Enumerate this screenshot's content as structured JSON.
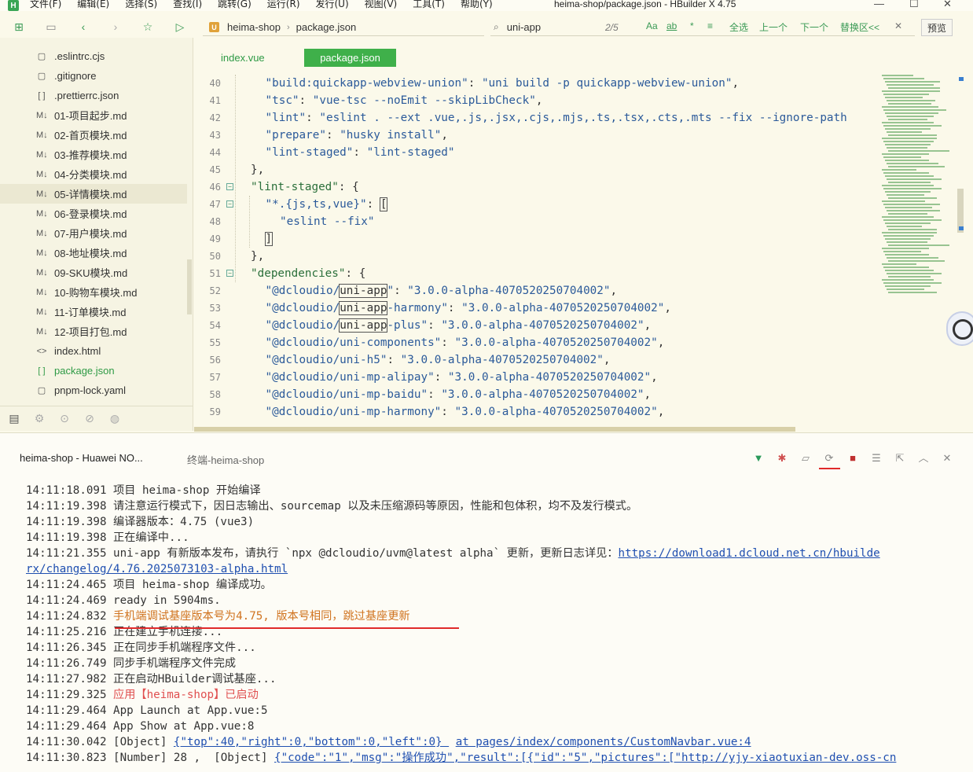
{
  "menu": {
    "items": [
      "文件(F)",
      "编辑(E)",
      "选择(S)",
      "查找(I)",
      "跳转(G)",
      "运行(R)",
      "发行(U)",
      "视图(V)",
      "工具(T)",
      "帮助(Y)"
    ],
    "window_title": "heima-shop/package.json - HBuilder X 4.75",
    "logo": "H"
  },
  "toolbar": {
    "address": {
      "project": "heima-shop",
      "file": "package.json",
      "icon": "U"
    },
    "search": {
      "value": "uni-app",
      "count": "2/5"
    },
    "search_options": [
      "Aa",
      "ab",
      "*",
      "≡",
      "全选",
      "上一个",
      "下一个",
      "替换区<<",
      "✕"
    ],
    "preview_label": "预览"
  },
  "sidebar": {
    "files": [
      {
        "name": ".eslintrc.cjs",
        "icon": "▢"
      },
      {
        "name": ".gitignore",
        "icon": "▢"
      },
      {
        "name": ".prettierrc.json",
        "icon": "[ ]"
      },
      {
        "name": "01-项目起步.md",
        "icon": "M↓"
      },
      {
        "name": "02-首页模块.md",
        "icon": "M↓"
      },
      {
        "name": "03-推荐模块.md",
        "icon": "M↓"
      },
      {
        "name": "04-分类模块.md",
        "icon": "M↓"
      },
      {
        "name": "05-详情模块.md",
        "icon": "M↓"
      },
      {
        "name": "06-登录模块.md",
        "icon": "M↓"
      },
      {
        "name": "07-用户模块.md",
        "icon": "M↓"
      },
      {
        "name": "08-地址模块.md",
        "icon": "M↓"
      },
      {
        "name": "09-SKU模块.md",
        "icon": "M↓"
      },
      {
        "name": "10-购物车模块.md",
        "icon": "M↓"
      },
      {
        "name": "11-订单模块.md",
        "icon": "M↓"
      },
      {
        "name": "12-项目打包.md",
        "icon": "M↓"
      },
      {
        "name": "index.html",
        "icon": "<>"
      },
      {
        "name": "package.json",
        "icon": "[ ]"
      },
      {
        "name": "pnpm-lock.yaml",
        "icon": "▢"
      }
    ],
    "selected_index": 7,
    "active_index": 16
  },
  "editor": {
    "tabs": [
      {
        "label": "index.vue"
      },
      {
        "label": "package.json"
      }
    ],
    "lines": [
      {
        "n": "40",
        "fold": false,
        "indent": 2,
        "parts": [
          [
            "s",
            "\"build:quickapp-webview-union\""
          ],
          [
            "p",
            ": "
          ],
          [
            "s",
            "\"uni build -p quickapp-webview-union\""
          ],
          [
            "p",
            ","
          ]
        ]
      },
      {
        "n": "41",
        "fold": false,
        "indent": 2,
        "parts": [
          [
            "s",
            "\"tsc\""
          ],
          [
            "p",
            ": "
          ],
          [
            "s",
            "\"vue-tsc --noEmit --skipLibCheck\""
          ],
          [
            "p",
            ","
          ]
        ]
      },
      {
        "n": "42",
        "fold": false,
        "indent": 2,
        "parts": [
          [
            "s",
            "\"lint\""
          ],
          [
            "p",
            ": "
          ],
          [
            "s",
            "\"eslint . --ext .vue,.js,.jsx,.cjs,.mjs,.ts,.tsx,.cts,.mts --fix --ignore-path"
          ]
        ]
      },
      {
        "n": "43",
        "fold": false,
        "indent": 2,
        "parts": [
          [
            "s",
            "\"prepare\""
          ],
          [
            "p",
            ": "
          ],
          [
            "s",
            "\"husky install\""
          ],
          [
            "p",
            ","
          ]
        ]
      },
      {
        "n": "44",
        "fold": false,
        "indent": 2,
        "parts": [
          [
            "s",
            "\"lint-staged\""
          ],
          [
            "p",
            ": "
          ],
          [
            "s",
            "\"lint-staged\""
          ]
        ]
      },
      {
        "n": "45",
        "fold": false,
        "indent": 1,
        "parts": [
          [
            "p",
            "},"
          ]
        ]
      },
      {
        "n": "46",
        "fold": true,
        "indent": 1,
        "parts": [
          [
            "k",
            "\"lint-staged\""
          ],
          [
            "p",
            ": {"
          ]
        ]
      },
      {
        "n": "47",
        "fold": true,
        "indent": 2,
        "parts": [
          [
            "s",
            "\"*.{js,ts,vue}\""
          ],
          [
            "p",
            ": "
          ],
          [
            "box",
            "["
          ]
        ]
      },
      {
        "n": "48",
        "fold": false,
        "indent": 3,
        "parts": [
          [
            "s",
            "\"eslint --fix\""
          ]
        ]
      },
      {
        "n": "49",
        "fold": false,
        "indent": 2,
        "parts": [
          [
            "box",
            "]"
          ]
        ]
      },
      {
        "n": "50",
        "fold": false,
        "indent": 1,
        "parts": [
          [
            "p",
            "},"
          ]
        ]
      },
      {
        "n": "51",
        "fold": true,
        "indent": 1,
        "parts": [
          [
            "k",
            "\"dependencies\""
          ],
          [
            "p",
            ": {"
          ]
        ]
      },
      {
        "n": "52",
        "fold": false,
        "indent": 2,
        "parts": [
          [
            "s",
            "\"@dcloudio/"
          ],
          [
            "box",
            "uni-app"
          ],
          [
            "s",
            "\""
          ],
          [
            "p",
            ": "
          ],
          [
            "s",
            "\"3.0.0-alpha-4070520250704002\""
          ],
          [
            "p",
            ","
          ]
        ]
      },
      {
        "n": "53",
        "fold": false,
        "indent": 2,
        "parts": [
          [
            "s",
            "\"@dcloudio/"
          ],
          [
            "box",
            "uni-app"
          ],
          [
            "s",
            "-harmony\""
          ],
          [
            "p",
            ": "
          ],
          [
            "s",
            "\"3.0.0-alpha-4070520250704002\""
          ],
          [
            "p",
            ","
          ]
        ]
      },
      {
        "n": "54",
        "fold": false,
        "indent": 2,
        "parts": [
          [
            "s",
            "\"@dcloudio/"
          ],
          [
            "box",
            "uni-app"
          ],
          [
            "s",
            "-plus\""
          ],
          [
            "p",
            ": "
          ],
          [
            "s",
            "\"3.0.0-alpha-4070520250704002\""
          ],
          [
            "p",
            ","
          ]
        ]
      },
      {
        "n": "55",
        "fold": false,
        "indent": 2,
        "parts": [
          [
            "s",
            "\"@dcloudio/uni-components\""
          ],
          [
            "p",
            ": "
          ],
          [
            "s",
            "\"3.0.0-alpha-4070520250704002\""
          ],
          [
            "p",
            ","
          ]
        ]
      },
      {
        "n": "56",
        "fold": false,
        "indent": 2,
        "parts": [
          [
            "s",
            "\"@dcloudio/uni-h5\""
          ],
          [
            "p",
            ": "
          ],
          [
            "s",
            "\"3.0.0-alpha-4070520250704002\""
          ],
          [
            "p",
            ","
          ]
        ]
      },
      {
        "n": "57",
        "fold": false,
        "indent": 2,
        "parts": [
          [
            "s",
            "\"@dcloudio/uni-mp-alipay\""
          ],
          [
            "p",
            ": "
          ],
          [
            "s",
            "\"3.0.0-alpha-4070520250704002\""
          ],
          [
            "p",
            ","
          ]
        ]
      },
      {
        "n": "58",
        "fold": false,
        "indent": 2,
        "parts": [
          [
            "s",
            "\"@dcloudio/uni-mp-baidu\""
          ],
          [
            "p",
            ": "
          ],
          [
            "s",
            "\"3.0.0-alpha-4070520250704002\""
          ],
          [
            "p",
            ","
          ]
        ]
      },
      {
        "n": "59",
        "fold": false,
        "indent": 2,
        "parts": [
          [
            "s",
            "\"@dcloudio/uni-mp-harmony\""
          ],
          [
            "p",
            ": "
          ],
          [
            "s",
            "\"3.0.0-alpha-4070520250704002\""
          ],
          [
            "p",
            ","
          ]
        ]
      }
    ]
  },
  "console": {
    "tabs": [
      {
        "label": "heima-shop - Huawei NO..."
      },
      {
        "label": "终端-heima-shop"
      }
    ],
    "lines": [
      {
        "time": "14:11:18.091",
        "parts": [
          [
            "t",
            "项目 heima-shop 开始编译"
          ]
        ]
      },
      {
        "time": "14:11:19.398",
        "parts": [
          [
            "t",
            "请注意运行模式下，因日志输出、sourcemap 以及未压缩源码等原因，性能和包体积，均不及发行模式。"
          ]
        ]
      },
      {
        "time": "14:11:19.398",
        "parts": [
          [
            "t",
            "编译器版本：4.75 (vue3)"
          ]
        ]
      },
      {
        "time": "14:11:19.398",
        "parts": [
          [
            "t",
            "正在编译中..."
          ]
        ]
      },
      {
        "time": "14:11:21.355",
        "parts": [
          [
            "t",
            "uni-app 有新版本发布，请执行 `npx @dcloudio/uvm@latest alpha` 更新，更新日志详见："
          ],
          [
            "link",
            "https://download1.dcloud.net.cn/hbuilde"
          ]
        ]
      },
      {
        "time": "",
        "parts": [
          [
            "link",
            "rx/changelog/4.76.2025073103-alpha.html"
          ]
        ]
      },
      {
        "time": "14:11:24.465",
        "parts": [
          [
            "t",
            "项目 heima-shop 编译成功。"
          ]
        ]
      },
      {
        "time": "14:11:24.469",
        "parts": [
          [
            "t",
            "ready in 5904ms."
          ]
        ]
      },
      {
        "time": "14:11:24.832",
        "parts": [
          [
            "orange",
            "手机端调试基座版本号为4.75, 版本号相同，跳过基座更新"
          ]
        ]
      },
      {
        "time": "14:11:25.216",
        "parts": [
          [
            "t",
            "正在建立手机连接..."
          ]
        ]
      },
      {
        "time": "14:11:26.345",
        "parts": [
          [
            "t",
            "正在同步手机端程序文件..."
          ]
        ]
      },
      {
        "time": "14:11:26.749",
        "parts": [
          [
            "t",
            "同步手机端程序文件完成"
          ]
        ]
      },
      {
        "time": "14:11:27.982",
        "parts": [
          [
            "t",
            "正在启动HBuilder调试基座..."
          ]
        ]
      },
      {
        "time": "14:11:29.325",
        "parts": [
          [
            "red",
            "应用【heima-shop】已启动"
          ]
        ]
      },
      {
        "time": "14:11:29.464",
        "parts": [
          [
            "t",
            "App Launch at App.vue:5"
          ]
        ]
      },
      {
        "time": "14:11:29.464",
        "parts": [
          [
            "t",
            "App Show at App.vue:8"
          ]
        ]
      },
      {
        "time": "14:11:30.042",
        "parts": [
          [
            "t",
            "[Object] "
          ],
          [
            "link",
            "{\"top\":40,\"right\":0,\"bottom\":0,\"left\":0} "
          ],
          [
            "t",
            " "
          ],
          [
            "link",
            "at pages/index/components/CustomNavbar.vue:4"
          ]
        ]
      },
      {
        "time": "14:11:30.823",
        "parts": [
          [
            "t",
            "[Number] 28 ,  [Object] "
          ],
          [
            "link",
            "{\"code\":\"1\",\"msg\":\"操作成功\",\"result\":[{\"id\":\"5\",\"pictures\":[\"http://yjy-xiaotuxian-dev.oss-cn"
          ]
        ]
      }
    ]
  },
  "colors": {
    "accent": "#3fb04a",
    "background": "#fbf9ea",
    "orange_log": "#d0731f",
    "red_log": "#e05050",
    "link": "#1f4fb0"
  }
}
